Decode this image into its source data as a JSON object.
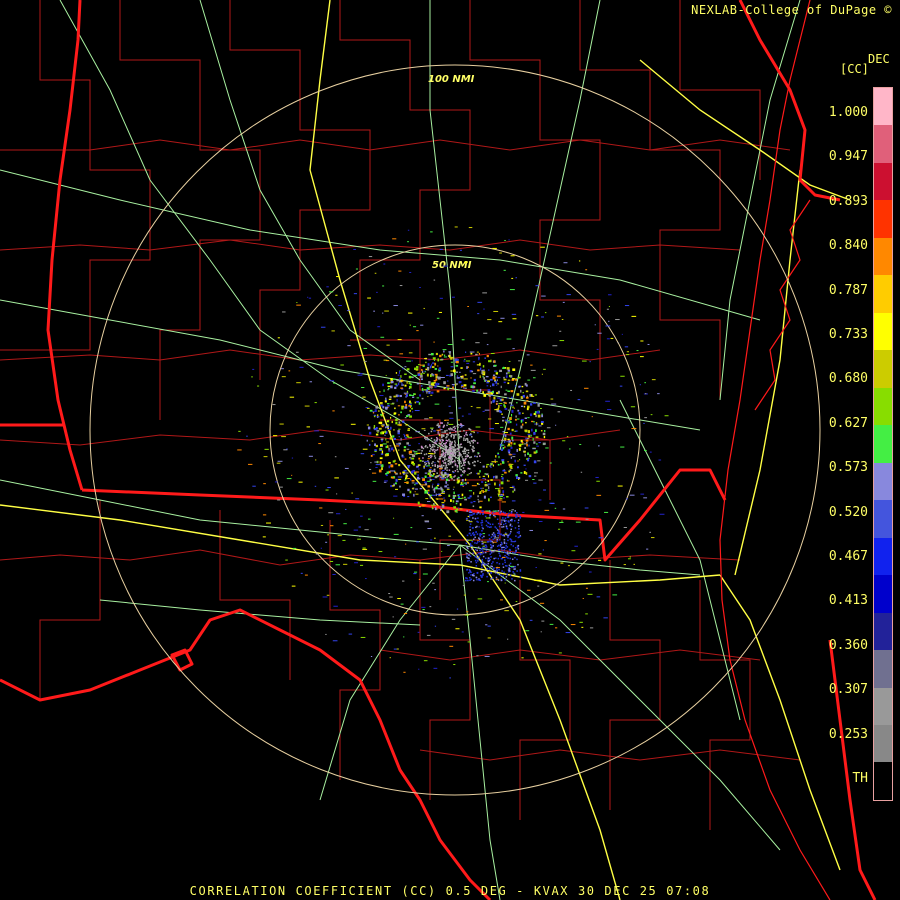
{
  "header": {
    "credit": "NEXLAB-College of DuPage ©",
    "legend_suffix": "DEC",
    "product_abbr": "[CC]"
  },
  "range_rings": [
    {
      "label": "100 NMI"
    },
    {
      "label": "50 NMI"
    }
  ],
  "legend": {
    "labels": [
      "1.000",
      "0.947",
      "0.893",
      "0.840",
      "0.787",
      "0.733",
      "0.680",
      "0.627",
      "0.573",
      "0.520",
      "0.467",
      "0.413",
      "0.360",
      "0.307",
      "0.253",
      "TH"
    ],
    "colors": [
      "#ffb6c8",
      "#e0607a",
      "#cc1030",
      "#ff3300",
      "#ff8800",
      "#ffcc00",
      "#ffff00",
      "#cccc00",
      "#88dd00",
      "#44ee44",
      "#8888dd",
      "#4455dd",
      "#1122ee",
      "#0000cc",
      "#222299",
      "#707090",
      "#999999",
      "#888888",
      "#000000"
    ]
  },
  "footer": {
    "caption": "CORRELATION COEFFICIENT (CC) 0.5 DEG - KVAX 30 DEC 25 07:08"
  },
  "colors": {
    "state_border": "#ff1a1a",
    "county_border": "#b01818",
    "highway": "#ffff44",
    "road": "#a8f0a0",
    "ring": "#e8d0a0",
    "text": "#ffff66"
  }
}
